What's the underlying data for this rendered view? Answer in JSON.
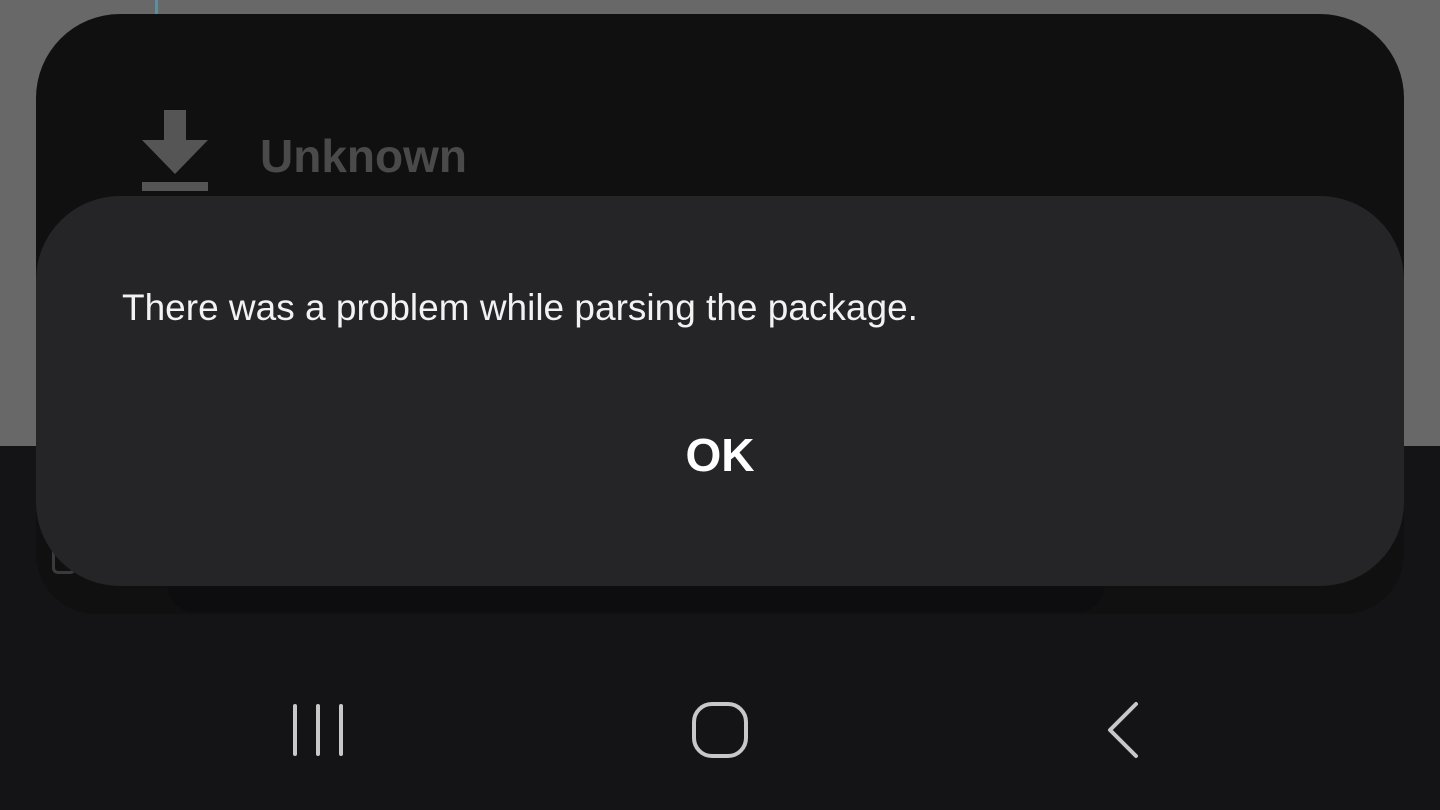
{
  "installer": {
    "title": "Unknown",
    "icon": "download-icon"
  },
  "dialog": {
    "message": "There was a problem while parsing the package.",
    "ok_label": "OK"
  },
  "navbar": {
    "recents_icon": "recents-icon",
    "home_icon": "home-icon",
    "back_icon": "back-icon"
  },
  "colors": {
    "dialog_background": "#252528",
    "dialog_text": "#f2f2f2",
    "scrim": "#676767",
    "navbar_background": "#141416"
  }
}
